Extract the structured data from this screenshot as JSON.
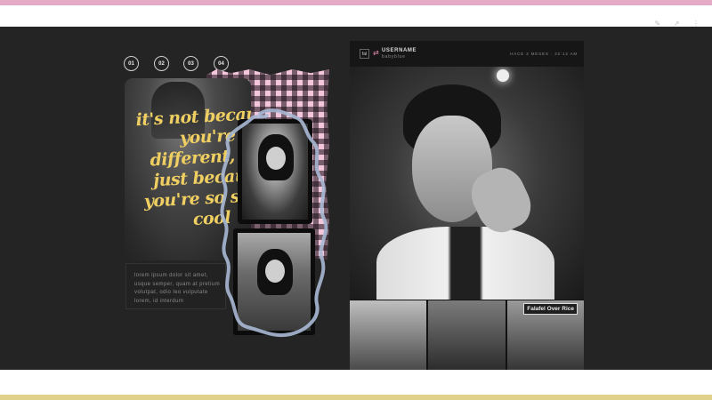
{
  "colors": {
    "top_stripe": "#e4aac6",
    "bottom_stripe": "#dfd08a",
    "stage_bg": "#242424",
    "quote_text": "#f0cf62",
    "squiggle": "#a9b8d4"
  },
  "topbar": {
    "icons": [
      "settings-icon",
      "arrow-icon",
      "menu-icon"
    ],
    "glyphs": "✎ ↗ ⋮"
  },
  "nav": {
    "items": [
      "01",
      "02",
      "03",
      "04"
    ]
  },
  "quote_card": {
    "text": "it's not because\nyou're\ndifferent, it's\njust because\nyou're so scary\ncool"
  },
  "caption": {
    "text": "lorem ipsum dolor sit amet, usque semper, quam at pretium volutpat, odio leo vulputate lorem, id interdum"
  },
  "post": {
    "avatar_label": "fal",
    "username": "USERNAME",
    "handle": "babyblue",
    "timestamp": "HACE 2 MESES · 22:12 AM",
    "sign_text": "Falafel Over Rice"
  }
}
